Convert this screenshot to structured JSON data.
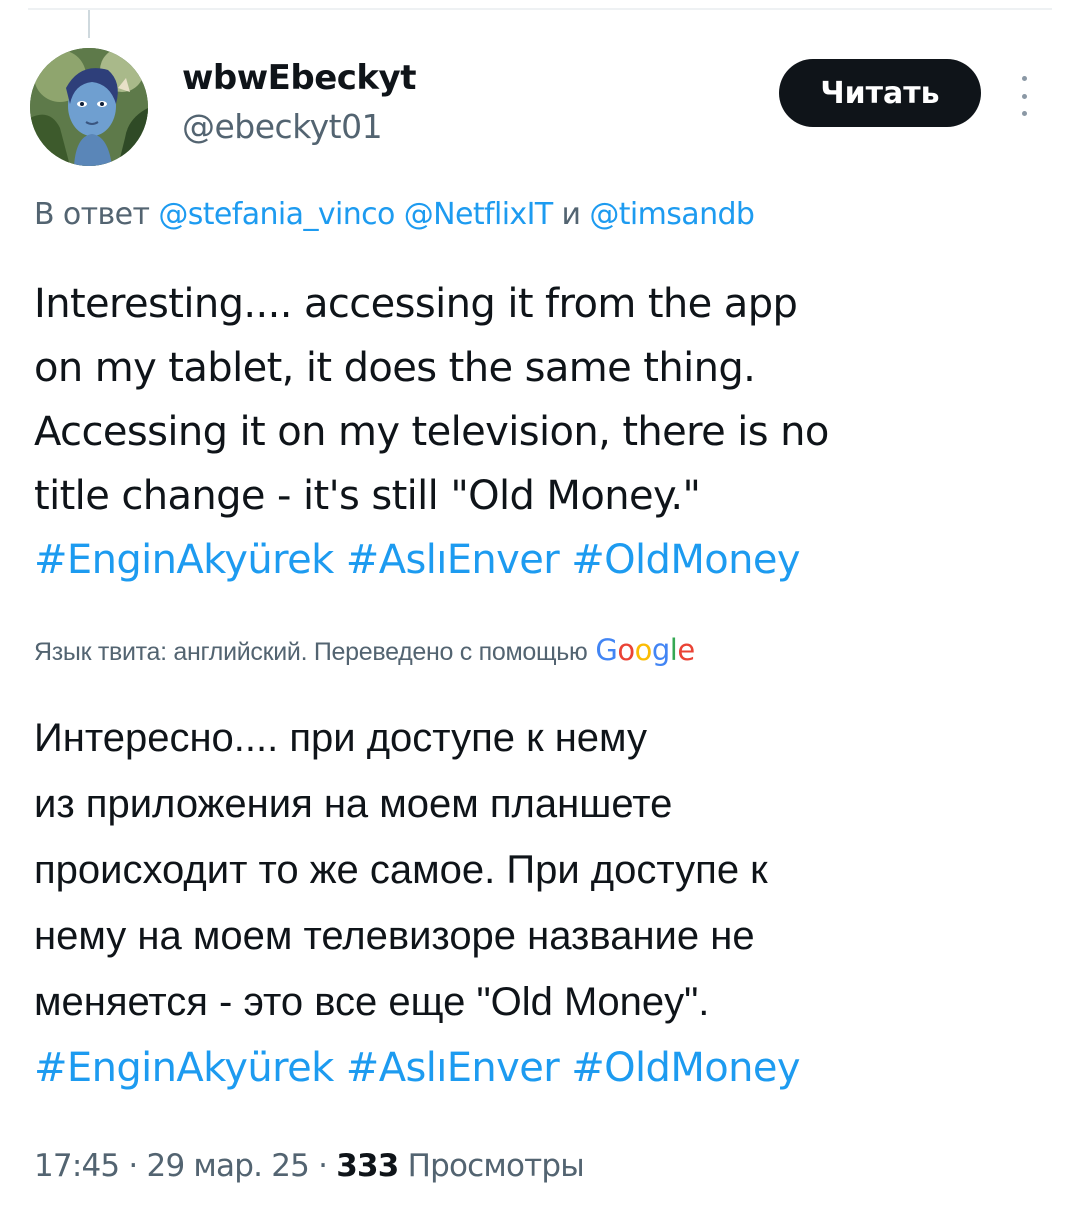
{
  "author": {
    "display_name": "wbwEbeckyt",
    "handle": "@ebeckyt01",
    "avatar": "avatar-image"
  },
  "follow_button": {
    "label": "Читать"
  },
  "more_menu": {
    "icon": "more-vertical-icon"
  },
  "reply_to": {
    "prefix": "В ответ",
    "mention_1": "@stefania_vinco",
    "mention_2": "@NetflixIT",
    "conjunction": "и",
    "mention_3": "@timsandb"
  },
  "tweet": {
    "lines": [
      "Interesting....  accessing it from the app",
      "on my tablet, it does the same thing.",
      "Accessing it on my television, there is no",
      "title change - it's still \"Old Money.\""
    ],
    "hashtags": [
      "#EnginAkyürek",
      "#AslıEnver",
      "#OldMoney"
    ]
  },
  "translation": {
    "note": "Язык твита: английский. Переведено с помощью",
    "provider": "Google",
    "lines": [
      "Интересно.... при доступе к нему",
      "из приложения на моем планшете",
      "происходит то же самое. При доступе к",
      "нему на моем телевизоре название не",
      "меняется - это все еще \"Old Money\"."
    ],
    "hashtags": [
      "#EnginAkyürek",
      "#AslıEnver",
      "#OldMoney"
    ]
  },
  "meta": {
    "time": "17:45",
    "separator": "·",
    "date": "29 мар. 25",
    "views_count": "333",
    "views_label": "Просмотры"
  },
  "colors": {
    "link": "#1d9bf0",
    "secondary_text": "#536471",
    "primary_text": "#0f1419",
    "button_bg": "#0f1419"
  }
}
